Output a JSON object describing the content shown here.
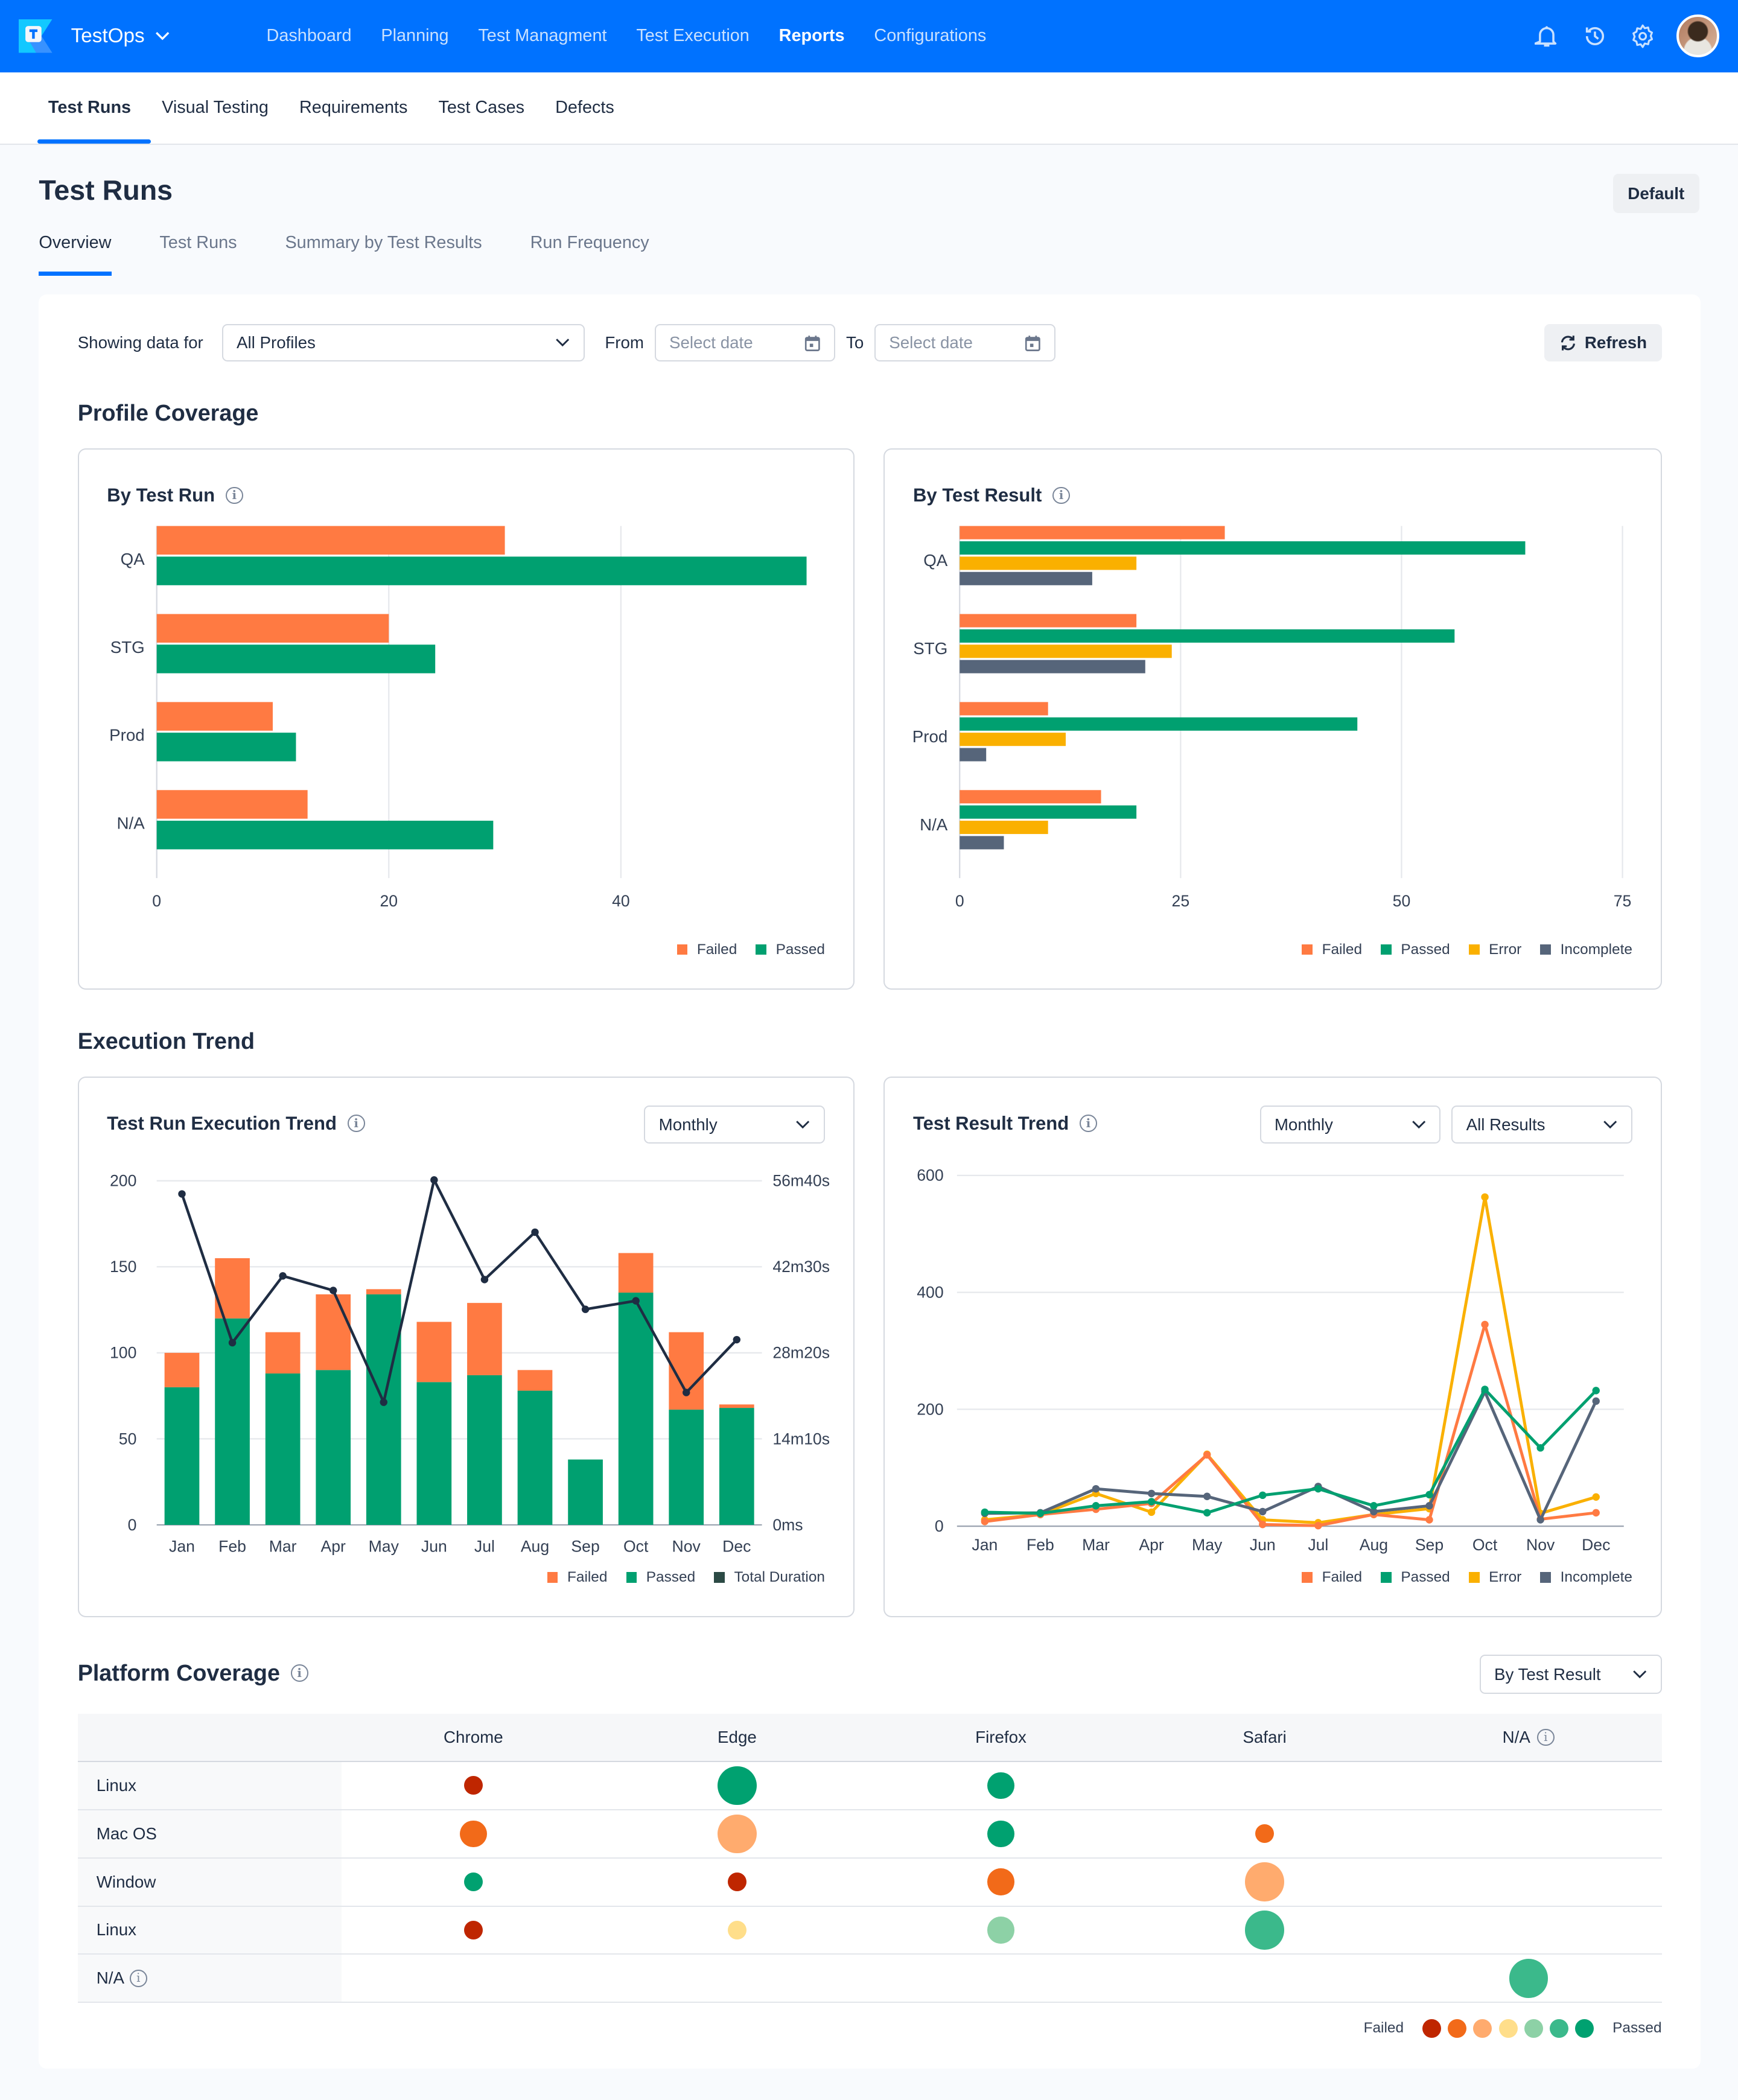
{
  "app": {
    "brand": "TestOps",
    "top_nav": [
      {
        "label": "Dashboard",
        "active": false
      },
      {
        "label": "Planning",
        "active": false
      },
      {
        "label": "Test Managment",
        "active": false
      },
      {
        "label": "Test Execution",
        "active": false
      },
      {
        "label": "Reports",
        "active": true
      },
      {
        "label": "Configurations",
        "active": false
      }
    ],
    "icons": [
      "bell-icon",
      "history-icon",
      "gear-icon",
      "avatar"
    ],
    "accent": "#0072FF"
  },
  "sub_nav": [
    {
      "label": "Test Runs",
      "active": true
    },
    {
      "label": "Visual Testing",
      "active": false
    },
    {
      "label": "Requirements",
      "active": false
    },
    {
      "label": "Test Cases",
      "active": false
    },
    {
      "label": "Defects",
      "active": false
    }
  ],
  "page": {
    "title": "Test Runs",
    "default_button": "Default",
    "tabs": [
      {
        "label": "Overview",
        "active": true
      },
      {
        "label": "Test Runs",
        "active": false
      },
      {
        "label": "Summary by Test Results",
        "active": false
      },
      {
        "label": "Run Frequency",
        "active": false
      }
    ]
  },
  "filters": {
    "showing_label": "Showing data for",
    "profile_value": "All Profiles",
    "from_label": "From",
    "from_placeholder": "Select date",
    "to_label": "To",
    "to_placeholder": "Select date",
    "refresh_label": "Refresh"
  },
  "sections": {
    "profile_coverage": "Profile Coverage",
    "execution_trend": "Execution Trend",
    "platform_coverage": "Platform Coverage"
  },
  "colors": {
    "failed": "#FF7A42",
    "passed": "#00A070",
    "error": "#FAB000",
    "incomplete": "#56657A",
    "duration": "#1F2D43"
  },
  "chart_data": [
    {
      "id": "by_test_run",
      "type": "bar",
      "orientation": "horizontal",
      "title": "By Test Run",
      "categories": [
        "QA",
        "STG",
        "Prod",
        "N/A"
      ],
      "series": [
        {
          "name": "Failed",
          "values": [
            30,
            20,
            10,
            13
          ]
        },
        {
          "name": "Passed",
          "values": [
            56,
            24,
            12,
            29
          ]
        }
      ],
      "xticks": [
        "0",
        "20",
        "40"
      ],
      "xlim": [
        0,
        60
      ],
      "grid": true,
      "legend": "bottom-right"
    },
    {
      "id": "by_test_result",
      "type": "bar",
      "orientation": "horizontal",
      "title": "By Test Result",
      "categories": [
        "QA",
        "STG",
        "Prod",
        "N/A"
      ],
      "series": [
        {
          "name": "Failed",
          "values": [
            30,
            20,
            10,
            16
          ]
        },
        {
          "name": "Passed",
          "values": [
            64,
            56,
            45,
            20
          ]
        },
        {
          "name": "Error",
          "values": [
            20,
            24,
            12,
            10
          ]
        },
        {
          "name": "Incomplete",
          "values": [
            15,
            21,
            3,
            5
          ]
        }
      ],
      "xticks": [
        "0",
        "25",
        "50",
        "75"
      ],
      "xlim": [
        0,
        75
      ],
      "grid": true,
      "legend": "bottom-right"
    },
    {
      "id": "run_execution_trend",
      "type": "bar",
      "stacked": true,
      "title": "Test Run Execution Trend",
      "period_select": "Monthly",
      "categories": [
        "Jan",
        "Feb",
        "Mar",
        "Apr",
        "May",
        "Jun",
        "Jul",
        "Aug",
        "Sep",
        "Oct",
        "Nov",
        "Dec"
      ],
      "series": [
        {
          "name": "Passed",
          "values": [
            80,
            120,
            88,
            90,
            134,
            83,
            87,
            78,
            38,
            135,
            67,
            68
          ]
        },
        {
          "name": "Failed",
          "values": [
            20,
            35,
            24,
            44,
            3,
            35,
            42,
            12,
            0,
            23,
            45,
            2
          ]
        },
        {
          "name": "Total Duration",
          "type": "line",
          "axis": "right",
          "unit": "minutes",
          "values": [
            54.5,
            30.0,
            41.0,
            38.6,
            20.2,
            56.8,
            40.4,
            48.2,
            35.5,
            36.9,
            21.8,
            30.5
          ]
        }
      ],
      "yticks_left": [
        "0",
        "50",
        "100",
        "150",
        "200"
      ],
      "ylim_left": [
        0,
        200
      ],
      "yticks_right": [
        "0ms",
        "14m10s",
        "28m20s",
        "42m30s",
        "56m40s"
      ],
      "ylim_right_minutes": [
        0,
        56.667
      ],
      "legend_items": [
        "Failed",
        "Passed",
        "Total Duration"
      ],
      "grid": true,
      "legend": "bottom-right"
    },
    {
      "id": "result_trend",
      "type": "line",
      "title": "Test Result Trend",
      "period_select": "Monthly",
      "result_select": "All Results",
      "categories": [
        "Jan",
        "Feb",
        "Mar",
        "Apr",
        "May",
        "Jun",
        "Jul",
        "Aug",
        "Sep",
        "Oct",
        "Nov",
        "Dec"
      ],
      "series": [
        {
          "name": "Failed",
          "values": [
            8,
            20,
            29,
            39,
            122,
            3,
            1,
            20,
            11,
            345,
            12,
            23
          ]
        },
        {
          "name": "Passed",
          "values": [
            24,
            22,
            35,
            42,
            23,
            53,
            64,
            35,
            54,
            234,
            134,
            232
          ]
        },
        {
          "name": "Error",
          "values": [
            11,
            20,
            56,
            24,
            123,
            11,
            6,
            20,
            30,
            563,
            22,
            50
          ]
        },
        {
          "name": "Incomplete",
          "values": [
            22,
            23,
            64,
            56,
            51,
            25,
            68,
            25,
            35,
            230,
            11,
            214
          ]
        }
      ],
      "yticks": [
        "0",
        "200",
        "400",
        "600"
      ],
      "ylim": [
        0,
        600
      ],
      "grid": true,
      "legend": "bottom-right"
    }
  ],
  "platform": {
    "select": "By Test Result",
    "columns": [
      "Chrome",
      "Edge",
      "Firefox",
      "Safari",
      "N/A"
    ],
    "rows": [
      {
        "label": "Linux",
        "cells": [
          {
            "size": "s",
            "color": "#BF2600"
          },
          {
            "size": "l",
            "color": "#00A170"
          },
          {
            "size": "m",
            "color": "#00A170"
          },
          null,
          null
        ]
      },
      {
        "label": "Mac OS",
        "cells": [
          {
            "size": "m",
            "color": "#F26A19"
          },
          {
            "size": "l",
            "color": "#FFAB6E"
          },
          {
            "size": "m",
            "color": "#00A170"
          },
          {
            "size": "s",
            "color": "#F26A19"
          },
          null
        ]
      },
      {
        "label": "Window",
        "cells": [
          {
            "size": "s",
            "color": "#00A170"
          },
          {
            "size": "s",
            "color": "#BF2600"
          },
          {
            "size": "m",
            "color": "#F26A19"
          },
          {
            "size": "l",
            "color": "#FFAB6E"
          },
          null
        ]
      },
      {
        "label": "Linux",
        "cells": [
          {
            "size": "s",
            "color": "#BF2600"
          },
          {
            "size": "s",
            "color": "#FFDE8A"
          },
          {
            "size": "m",
            "color": "#8DD1A6"
          },
          {
            "size": "l",
            "color": "#3BB98B"
          },
          null
        ]
      },
      {
        "label": "N/A",
        "info": true,
        "cells": [
          null,
          null,
          null,
          null,
          {
            "size": "l",
            "color": "#3BB98B"
          }
        ]
      }
    ],
    "legend": {
      "left": "Failed",
      "right": "Passed",
      "scale": [
        "#BF2600",
        "#F26A19",
        "#FFAB6E",
        "#FFDE8A",
        "#8DD1A6",
        "#3BB98B",
        "#00A170"
      ]
    }
  }
}
